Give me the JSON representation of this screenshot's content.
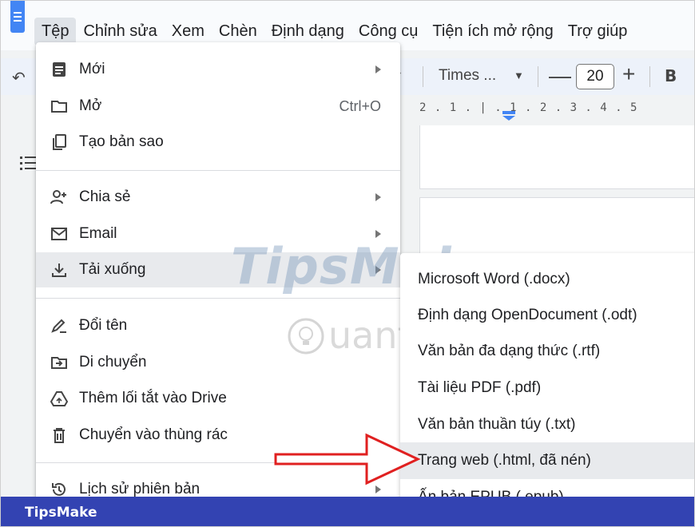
{
  "menubar": {
    "items": [
      "Tệp",
      "Chỉnh sửa",
      "Xem",
      "Chèn",
      "Định dạng",
      "Công cụ",
      "Tiện ích mở rộng",
      "Trợ giúp"
    ]
  },
  "toolbar": {
    "font_name": "Times ...",
    "font_size": "20",
    "bold_label": "B",
    "minus_label": "—",
    "plus_label": "+"
  },
  "ruler": {
    "text": "2 . 1 . | . 1 . 2 . 3 . 4 . 5"
  },
  "file_menu": {
    "items": [
      {
        "label": "Mới",
        "icon": "new-document-icon",
        "has_submenu": true
      },
      {
        "label": "Mở",
        "icon": "folder-icon",
        "shortcut": "Ctrl+O"
      },
      {
        "label": "Tạo bản sao",
        "icon": "copy-icon"
      },
      {
        "label": "Chia sẻ",
        "icon": "share-person-icon",
        "has_submenu": true
      },
      {
        "label": "Email",
        "icon": "email-icon",
        "has_submenu": true
      },
      {
        "label": "Tải xuống",
        "icon": "download-icon",
        "has_submenu": true,
        "highlighted": true
      },
      {
        "label": "Đổi tên",
        "icon": "rename-pencil-icon"
      },
      {
        "label": "Di chuyển",
        "icon": "move-folder-icon"
      },
      {
        "label": "Thêm lối tắt vào Drive",
        "icon": "drive-shortcut-icon"
      },
      {
        "label": "Chuyển vào thùng rác",
        "icon": "trash-icon"
      },
      {
        "label": "Lịch sử phiên bản",
        "icon": "history-icon",
        "has_submenu": true
      }
    ]
  },
  "download_submenu": {
    "items": [
      {
        "label": "Microsoft Word (.docx)"
      },
      {
        "label": "Định dạng OpenDocument (.odt)"
      },
      {
        "label": "Văn bản đa dạng thức (.rtf)"
      },
      {
        "label": "Tài liệu PDF (.pdf)"
      },
      {
        "label": "Văn bản thuần túy (.txt)"
      },
      {
        "label": "Trang web (.html, đã nén)",
        "highlighted": true
      },
      {
        "label": "Ấn bản EPUB (.epub)"
      }
    ]
  },
  "watermark": {
    "brand": "TipsMake",
    "secondary": "uantrimang"
  },
  "footer": {
    "brand": "TipsMake"
  },
  "colors": {
    "footer_bg": "#3343b2",
    "highlight_bg": "#e8eaed",
    "arrow_red": "#e02020",
    "docs_blue": "#4285f4"
  }
}
